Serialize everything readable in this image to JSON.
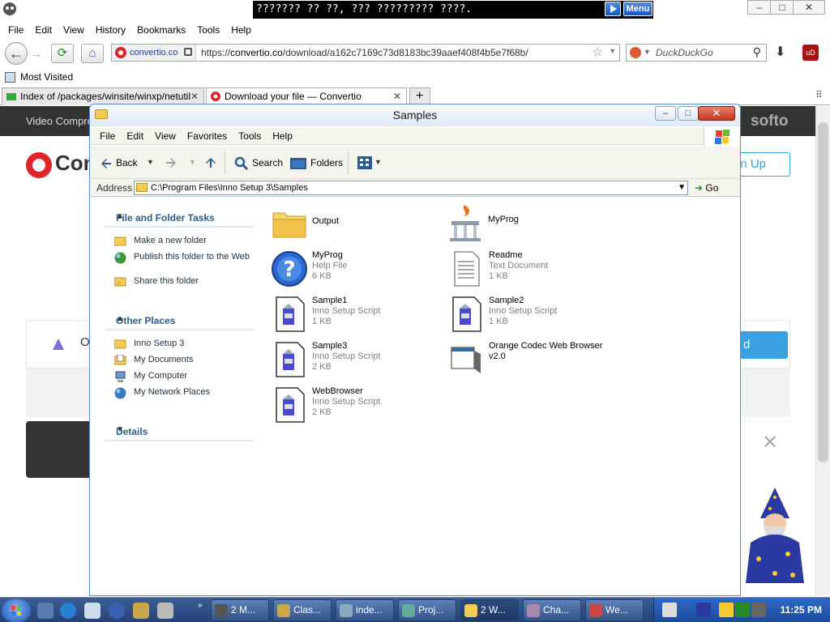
{
  "browser": {
    "window_title": "??????? ?? ??, ??? ????????? ????.",
    "menu_button": "Menu",
    "window_controls": [
      "–",
      "□",
      "✕"
    ],
    "menu": [
      "File",
      "Edit",
      "View",
      "History",
      "Bookmarks",
      "Tools",
      "Help"
    ],
    "site_badge": "convertio.co",
    "url_prefix": "https://",
    "url_domain": "convertio.co",
    "url_path": "/download/a162c7169c73d8183bc39aaef408f4b5e7f68b/",
    "search_engine": "DuckDuckGo",
    "bookmark": "Most Visited",
    "tabs": [
      {
        "title": "Index of /packages/winsite/winxp/netutil",
        "close": "✕"
      },
      {
        "title": "Download your file — Convertio",
        "close": "✕"
      }
    ],
    "new_tab": "+"
  },
  "site": {
    "top_left": "Video Compre",
    "top_right": "softo",
    "logo_text": "Con",
    "signup": "gn Up",
    "card_text": "O",
    "card_button": "d",
    "close": "✕"
  },
  "explorer": {
    "title": "Samples",
    "controls": {
      "min": "–",
      "max": "□",
      "close": "✕"
    },
    "menu": [
      "File",
      "Edit",
      "View",
      "Favorites",
      "Tools",
      "Help"
    ],
    "toolbar": {
      "back": "Back",
      "search": "Search",
      "folders": "Folders"
    },
    "address_label": "Address",
    "address_path": "C:\\Program Files\\Inno Setup 3\\Samples",
    "go": "Go",
    "tasks_title": "File and Folder Tasks",
    "tasks": [
      "Make a new folder",
      "Publish this folder to the Web",
      "Share this folder"
    ],
    "places_title": "Other Places",
    "places": [
      "Inno Setup 3",
      "My Documents",
      "My Computer",
      "My Network Places"
    ],
    "details_title": "Details",
    "files": [
      {
        "name": "Output",
        "type": "",
        "size": ""
      },
      {
        "name": "MyProg",
        "type": "",
        "size": ""
      },
      {
        "name": "MyProg",
        "type": "Help File",
        "size": "6 KB"
      },
      {
        "name": "Readme",
        "type": "Text Document",
        "size": "1 KB"
      },
      {
        "name": "Sample1",
        "type": "Inno Setup Script",
        "size": "1 KB"
      },
      {
        "name": "Sample2",
        "type": "Inno Setup Script",
        "size": "1 KB"
      },
      {
        "name": "Sample3",
        "type": "Inno Setup Script",
        "size": "2 KB"
      },
      {
        "name": "Orange Codec Web Browser v2.0",
        "type": "",
        "size": ""
      },
      {
        "name": "WebBrowser",
        "type": "Inno Setup Script",
        "size": "2 KB"
      }
    ]
  },
  "taskbar": {
    "tasks": [
      "2 M...",
      "Clas...",
      "inde...",
      "Proj...",
      "2 W...",
      "Cha...",
      "We..."
    ],
    "clock": "11:25 PM"
  },
  "colors": {
    "xp_blue": "#2c5e8c",
    "taskbar": "#25417a",
    "convertio_red": "#e0242a",
    "accent_blue": "#3aa0e0"
  }
}
